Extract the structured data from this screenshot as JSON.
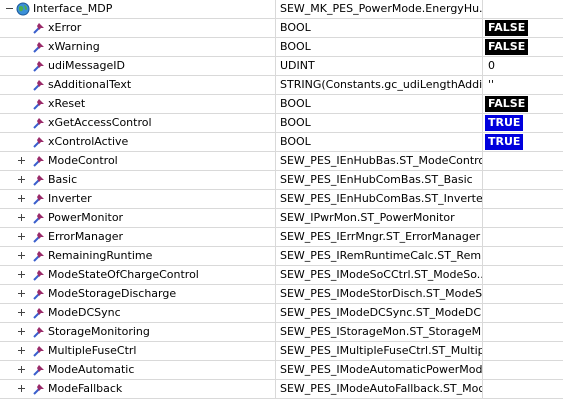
{
  "root": {
    "name": "Interface_MDP",
    "type": "SEW_MK_PES_PowerMode.EnergyHu...",
    "value": ""
  },
  "variables": [
    {
      "name": "xError",
      "type": "BOOL",
      "value": "FALSE",
      "style": "black"
    },
    {
      "name": "xWarning",
      "type": "BOOL",
      "value": "FALSE",
      "style": "black"
    },
    {
      "name": "udiMessageID",
      "type": "UDINT",
      "value": "0",
      "style": "plain"
    },
    {
      "name": "sAdditionalText",
      "type": "STRING(Constants.gc_udiLengthAdditi...",
      "value": "''",
      "style": "plain"
    },
    {
      "name": "xReset",
      "type": "BOOL",
      "value": "FALSE",
      "style": "black"
    },
    {
      "name": "xGetAccessControl",
      "type": "BOOL",
      "value": "TRUE",
      "style": "blue"
    },
    {
      "name": "xControlActive",
      "type": "BOOL",
      "value": "TRUE",
      "style": "blue"
    }
  ],
  "structs": [
    {
      "name": "ModeControl",
      "type": "SEW_PES_IEnHubBas.ST_ModeControl"
    },
    {
      "name": "Basic",
      "type": "SEW_PES_IEnHubComBas.ST_Basic"
    },
    {
      "name": "Inverter",
      "type": "SEW_PES_IEnHubComBas.ST_Inverter"
    },
    {
      "name": "PowerMonitor",
      "type": "SEW_IPwrMon.ST_PowerMonitor"
    },
    {
      "name": "ErrorManager",
      "type": "SEW_PES_IErrMngr.ST_ErrorManager"
    },
    {
      "name": "RemainingRuntime",
      "type": "SEW_PES_IRemRuntimeCalc.ST_Rem..."
    },
    {
      "name": "ModeStateOfChargeControl",
      "type": "SEW_PES_IModeSoCCtrl.ST_ModeSo..."
    },
    {
      "name": "ModeStorageDischarge",
      "type": "SEW_PES_IModeStorDisch.ST_ModeS..."
    },
    {
      "name": "ModeDCSync",
      "type": "SEW_PES_IModeDCSync.ST_ModeDC..."
    },
    {
      "name": "StorageMonitoring",
      "type": "SEW_PES_IStorageMon.ST_StorageM..."
    },
    {
      "name": "MultipleFuseCtrl",
      "type": "SEW_PES_IMultipleFuseCtrl.ST_Multipl..."
    },
    {
      "name": "ModeAutomatic",
      "type": "SEW_PES_IModeAutomaticPowerMod..."
    },
    {
      "name": "ModeFallback",
      "type": "SEW_PES_IModeAutoFallback.ST_Mod..."
    }
  ],
  "colors": {
    "false_bg": "#000000",
    "true_bg": "#0000dd",
    "grid": "#d9d9d9"
  },
  "icons": {
    "root": "globe-icon",
    "variable": "variable-pin-icon"
  }
}
